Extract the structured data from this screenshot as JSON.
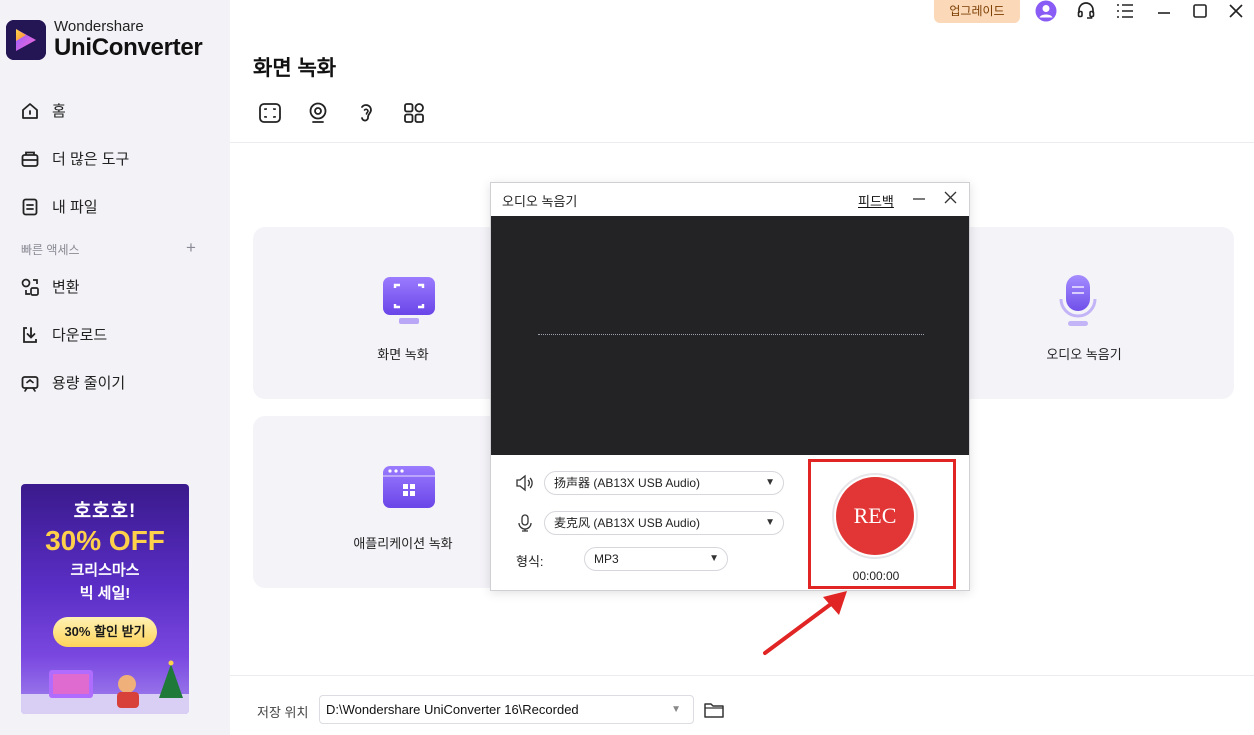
{
  "app": {
    "brand": "Wondershare",
    "product": "UniConverter"
  },
  "sidebar": {
    "items": [
      {
        "label": "홈",
        "icon": "home-icon"
      },
      {
        "label": "더 많은 도구",
        "icon": "toolbox-icon"
      },
      {
        "label": "내 파일",
        "icon": "file-icon"
      }
    ],
    "quick_access_label": "빠른 액세스",
    "quick_access_add": "+",
    "quick_items": [
      {
        "label": "변환",
        "icon": "convert-icon"
      },
      {
        "label": "다운로드",
        "icon": "download-icon"
      },
      {
        "label": "용량 줄이기",
        "icon": "compress-icon"
      }
    ],
    "promo": {
      "line1": "호호호!",
      "line2": "30% OFF",
      "line3": "크리스마스",
      "line4": "빅 세일!",
      "button": "30% 할인 받기"
    }
  },
  "topbar": {
    "upgrade_label": "업그레이드",
    "icons": [
      "user-avatar-icon",
      "headset-icon",
      "menu-icon",
      "minimize-icon",
      "maximize-icon",
      "close-icon"
    ]
  },
  "main": {
    "title": "화면 녹화",
    "tools": [
      "screen-capture-icon",
      "webcam-icon",
      "audio-record-icon",
      "apps-grid-icon"
    ],
    "cards": [
      {
        "label": "화면 녹화",
        "icon": "screen-record-icon"
      },
      {
        "label": "오디오 녹음기",
        "icon": "microphone-icon"
      },
      {
        "label": "애플리케이션 녹화",
        "icon": "app-window-icon"
      }
    ]
  },
  "dialog": {
    "title": "오디오 녹음기",
    "feedback": "피드백",
    "speaker_device": "扬声器 (AB13X USB Audio)",
    "mic_device": "麦克风 (AB13X USB Audio)",
    "format_label": "형식:",
    "format_value": "MP3",
    "rec_label": "REC",
    "timer": "00:00:00"
  },
  "bottom": {
    "save_label": "저장 위치",
    "save_path": "D:\\Wondershare UniConverter 16\\Recorded"
  },
  "colors": {
    "accent": "#7c5cf0",
    "rec_red": "#e23636",
    "highlight_red": "#e12424",
    "sidebar_bg": "#f3f2f7",
    "card_bg": "#f4f3f8",
    "wave_bg": "#232326"
  }
}
